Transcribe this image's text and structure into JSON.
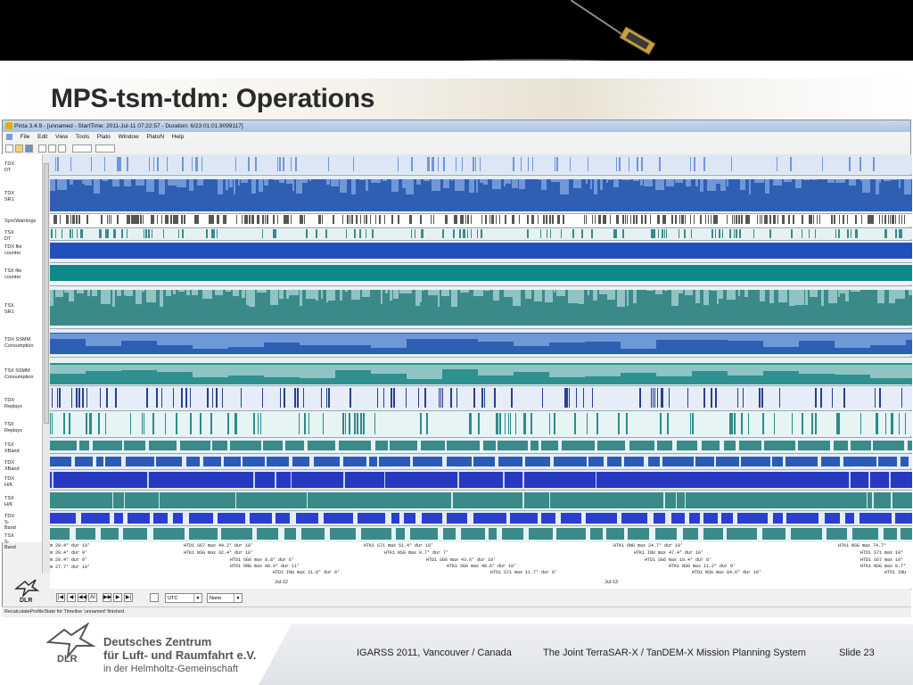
{
  "slide": {
    "title": "MPS-tsm-tdm: Operations",
    "footer": {
      "conference": "IGARSS 2011, Vancouver / Canada",
      "system": "The Joint TerraSAR-X / TanDEM-X Mission Planning System",
      "slide_number": "Slide 23"
    },
    "org": {
      "abbrev": "DLR",
      "line1": "Deutsches Zentrum",
      "line2": "für Luft- und Raumfahrt e.V.",
      "line3": "in der Helmholtz-Gemeinschaft"
    }
  },
  "app": {
    "window_title": "Pinta 3.4.9 - [unnamed - StartTime: 2011-Jul-11 07:22:57 - Duration: 6/23:01:01.9099117]",
    "menu": [
      "File",
      "Edit",
      "View",
      "Tools",
      "Plato",
      "Window",
      "PlatoN",
      "Help"
    ],
    "track_labels": [
      {
        "name": "TDX DT"
      },
      {
        "name": "TDX SR1"
      },
      {
        "name": "SyncWarnings"
      },
      {
        "name": "TSX DT"
      },
      {
        "name": "TDX file counter"
      },
      {
        "name": "TSX file counter"
      },
      {
        "name": "TSX SR1"
      },
      {
        "name": "TDX SSMM Consumption"
      },
      {
        "name": "TSX SSMM Consumption"
      },
      {
        "name": "TDX Replays"
      },
      {
        "name": "TSX Replays"
      },
      {
        "name": "TSX XBand"
      },
      {
        "name": "TDX XBand"
      },
      {
        "name": "TDX H/K"
      },
      {
        "name": "TSX H/K"
      },
      {
        "name": "TDX S-Band"
      },
      {
        "name": "TSX S-Band"
      }
    ],
    "timeline_annotations": [
      "m 20.4°  dur 10'",
      "m 20.4°  dur 9'",
      "m 20.4°  dur 9'",
      "m 27.7°  dur 10'",
      "HTD1 S67  max 44.2°  dur 10'",
      "HTK1 NSG  max 32.4°  dur 10'",
      "HTD1 SG6  max 8.8°  dur 6'",
      "HTD1 ONG  max 80.9°  dur 11'",
      "HTD1 INU  max 21.8°  dur 9'",
      "HTK1 S71  max 51.4°  dur 10'",
      "HTK1 NSG  max 9.7°  dur 7'",
      "HTD1 SG6  max 43.6°  dur 10'",
      "HTK1 SG6  max 48.6°  dur 10'",
      "HTD1 S71  max 11.7°  dur 8'",
      "HTK1 ONG  max 24.7°  dur 10'",
      "HTK1 INU  max 47.4°  dur 10'",
      "HTD1 SG6  max 10.4°  dur 8'",
      "HTK1 NSG  max 11.2°  dur 8'",
      "HTD1 NSG  max 84.6°  dur 10'",
      "HTK1 NSG  max 74.7°",
      "HTD1 S71  max 10°",
      "HTD1 S67  max 10°",
      "HTK1 NSG  max 8.7°",
      "HTD1 INU"
    ],
    "dates": [
      "Jul-12",
      "Jul-13"
    ],
    "timezone_select": "UTC",
    "filter_select": "None",
    "status": "RecalculateProfileState for Timeline 'unnamed' finished",
    "nav_buttons": [
      "|◀",
      "◀",
      "◀◀",
      "AI",
      "▶▶",
      "▶",
      "▶|"
    ]
  },
  "colors": {
    "tdx_blue": "#2f5fb3",
    "tdx_light": "#6f98d8",
    "tsx_teal": "#3a8a8a",
    "tsx_light": "#8fc4c4",
    "blue_bright": "#2a3fd0",
    "track_bg": "#dde6f4"
  }
}
